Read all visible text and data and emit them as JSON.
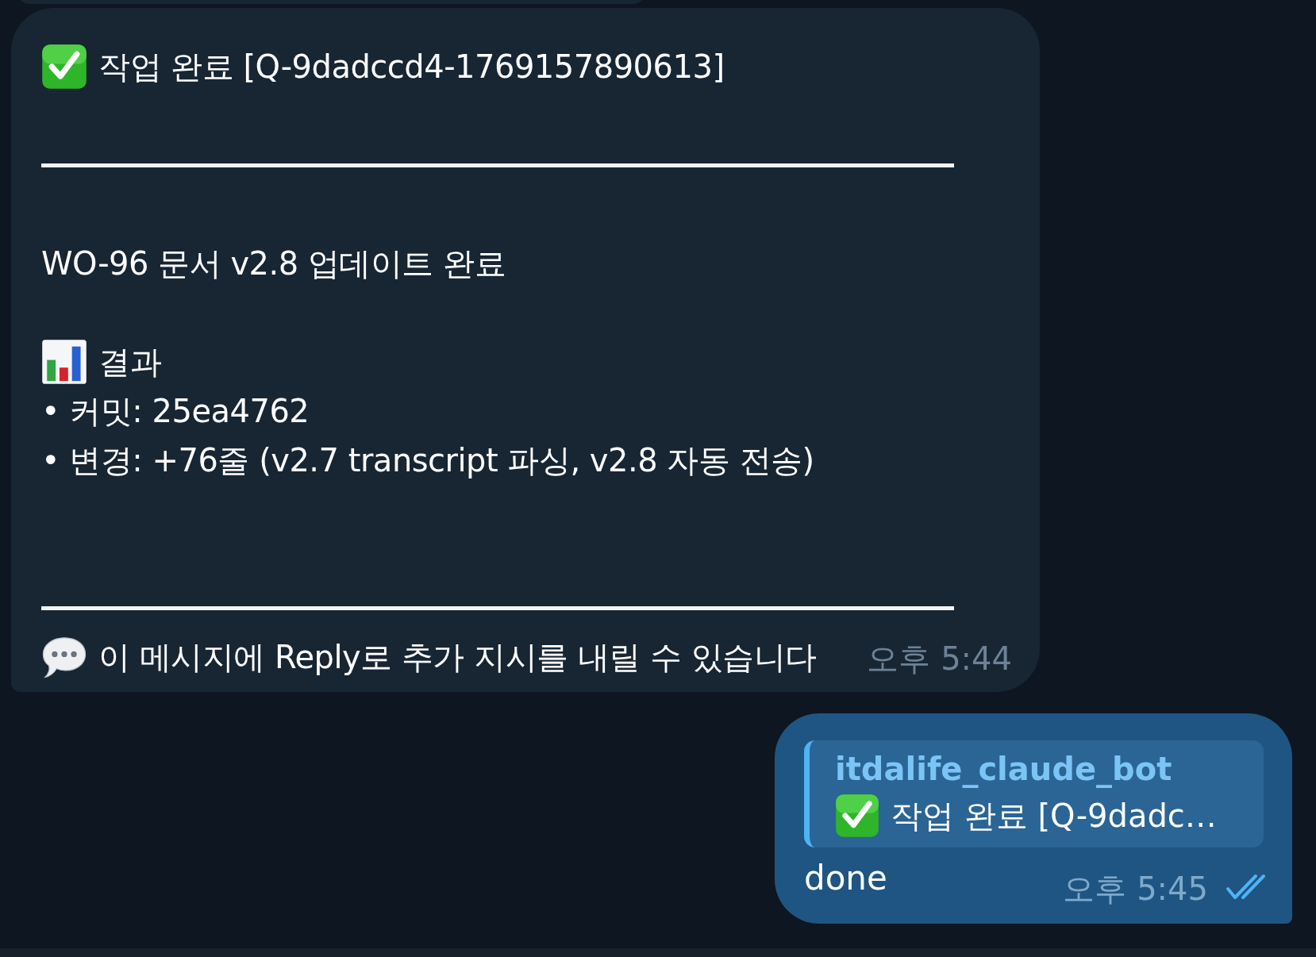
{
  "messages": [
    {
      "kind": "incoming",
      "lines": [
        {
          "kind": "check",
          "text": "작업 완료 [Q-9dadccd4-1769157890613]"
        },
        {
          "kind": "blank"
        },
        {
          "kind": "rule"
        },
        {
          "kind": "blank"
        },
        {
          "kind": "text",
          "text": "WO-96 문서 v2.8 업데이트 완료"
        },
        {
          "kind": "blank"
        },
        {
          "kind": "chart",
          "text": "결과"
        },
        {
          "kind": "text",
          "text": "• 커밋: 25ea4762"
        },
        {
          "kind": "text",
          "text": "• 변경: +76줄 (v2.7 transcript 파싱, v2.8 자동 전송)"
        },
        {
          "kind": "blank"
        },
        {
          "kind": "blank"
        },
        {
          "kind": "rule"
        },
        {
          "kind": "speech",
          "text": "이 메시지에 Reply로 추가 지시를 내릴 수 있습니다"
        }
      ],
      "time": "오후 5:44"
    },
    {
      "kind": "outgoing",
      "reply": {
        "author": "itdalife_claude_bot",
        "kind": "check",
        "text": "작업 완료 [Q-9dadc…"
      },
      "text": "done",
      "time": "오후 5:45",
      "read": true
    }
  ]
}
